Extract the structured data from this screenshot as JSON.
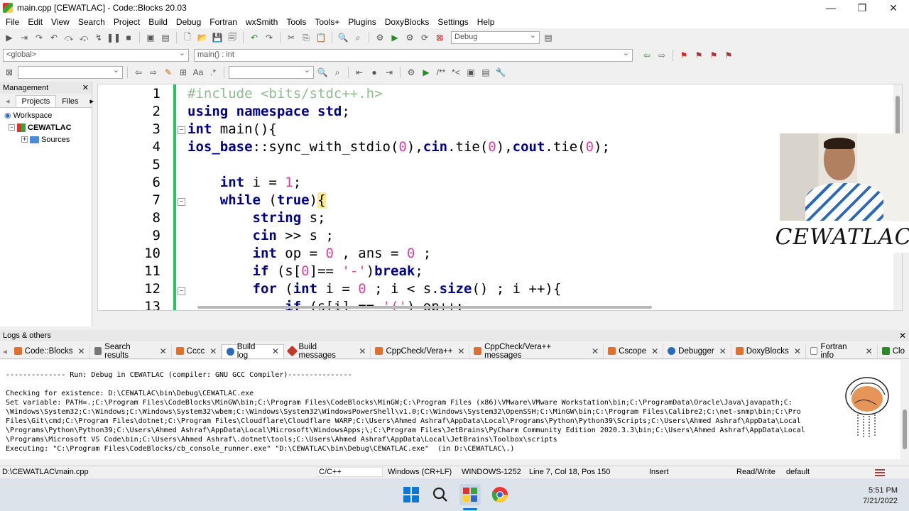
{
  "window": {
    "title": "main.cpp [CEWATLAC] - Code::Blocks 20.03"
  },
  "menu": [
    "File",
    "Edit",
    "View",
    "Search",
    "Project",
    "Build",
    "Debug",
    "Fortran",
    "wxSmith",
    "Tools",
    "Tools+",
    "Plugins",
    "DoxyBlocks",
    "Settings",
    "Help"
  ],
  "toolbar": {
    "build_target": "Debug"
  },
  "code_nav": {
    "scope": "<global>",
    "function": "main() : int"
  },
  "management": {
    "title": "Management",
    "tabs": [
      "Projects",
      "Files"
    ],
    "tree": [
      "Workspace",
      "CEWATLAC",
      "Sources"
    ]
  },
  "editor": {
    "line_numbers": [
      "1",
      "2",
      "3",
      "4",
      "5",
      "6",
      "7",
      "8",
      "9",
      "10",
      "11",
      "12",
      "13"
    ]
  },
  "webcam": {
    "brand": "CEWATLAC"
  },
  "logs": {
    "title": "Logs & others",
    "tabs": [
      "Code::Blocks",
      "Search results",
      "Cccc",
      "Build log",
      "Build messages",
      "CppCheck/Vera++",
      "CppCheck/Vera++ messages",
      "Cscope",
      "Debugger",
      "DoxyBlocks",
      "Fortran info",
      "Clo"
    ],
    "lines": [
      "-------------- Run: Debug in CEWATLAC (compiler: GNU GCC Compiler)---------------",
      "",
      "Checking for existence: D:\\CEWATLAC\\bin\\Debug\\CEWATLAC.exe",
      "Set variable: PATH=.;C:\\Program Files\\CodeBlocks\\MinGW\\bin;C:\\Program Files\\CodeBlocks\\MinGW;C:\\Program Files (x86)\\VMware\\VMware Workstation\\bin;C:\\ProgramData\\Oracle\\Java\\javapath;C:",
      "\\Windows\\System32;C:\\Windows;C:\\Windows\\System32\\wbem;C:\\Windows\\System32\\WindowsPowerShell\\v1.0;C:\\Windows\\System32\\OpenSSH;C:\\MinGW\\bin;C:\\Program Files\\Calibre2;C:\\net-snmp\\bin;C:\\Pro",
      "Files\\Git\\cmd;C:\\Program Files\\dotnet;C:\\Program Files\\Cloudflare\\Cloudflare WARP;C:\\Users\\Ahmed Ashraf\\AppData\\Local\\Programs\\Python\\Python39\\Scripts;C:\\Users\\Ahmed Ashraf\\AppData\\Local",
      "\\Programs\\Python\\Python39;C:\\Users\\Ahmed Ashraf\\AppData\\Local\\Microsoft\\WindowsApps;\\;C:\\Program Files\\JetBrains\\PyCharm Community Edition 2020.3.3\\bin;C:\\Users\\Ahmed Ashraf\\AppData\\Local",
      "\\Programs\\Microsoft VS Code\\bin;C:\\Users\\Ahmed Ashraf\\.dotnet\\tools;C:\\Users\\Ahmed Ashraf\\AppData\\Local\\JetBrains\\Toolbox\\scripts",
      "Executing: \"C:\\Program Files\\CodeBlocks/cb_console_runner.exe\" \"D:\\CEWATLAC\\bin\\Debug\\CEWATLAC.exe\"  (in D:\\CEWATLAC\\.)"
    ]
  },
  "status": {
    "file": "D:\\CEWATLAC\\main.cpp",
    "lang": "C/C++",
    "eol": "Windows (CR+LF)",
    "encoding": "WINDOWS-1252",
    "position": "Line 7, Col 18, Pos 150",
    "mode": "Insert",
    "access": "Read/Write",
    "profile": "default"
  },
  "clock": {
    "time": "5:51 PM",
    "date": "7/21/2022"
  }
}
